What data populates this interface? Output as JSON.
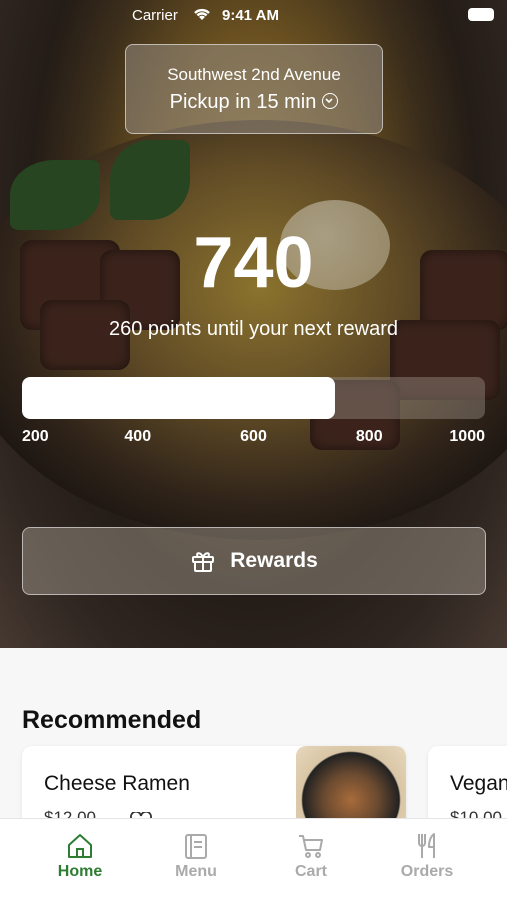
{
  "status_bar": {
    "carrier": "Carrier",
    "time": "9:41 AM"
  },
  "store": {
    "name": "Southwest 2nd Avenue",
    "pickup": "Pickup in 15 min"
  },
  "points": {
    "current": 740,
    "current_text": "740",
    "message": "260 points until your next reward",
    "progress": {
      "min": 200,
      "max": 1000,
      "value": 740,
      "ticks": [
        "200",
        "400",
        "600",
        "800",
        "1000"
      ]
    }
  },
  "rewards_button": {
    "label": "Rewards"
  },
  "recommended": {
    "heading": "Recommended",
    "items": [
      {
        "name": "Cheese Ramen",
        "price": "$12.00"
      },
      {
        "name": "Vegan",
        "price": "$10.00"
      }
    ]
  },
  "tabbar": {
    "tabs": [
      {
        "label": "Home",
        "icon": "home-icon",
        "active": true
      },
      {
        "label": "Menu",
        "icon": "menu-book-icon",
        "active": false
      },
      {
        "label": "Cart",
        "icon": "cart-icon",
        "active": false
      },
      {
        "label": "Orders",
        "icon": "fork-knife-icon",
        "active": false
      }
    ]
  },
  "colors": {
    "accent": "#2e7d32",
    "inactive": "#aaaaaa"
  }
}
